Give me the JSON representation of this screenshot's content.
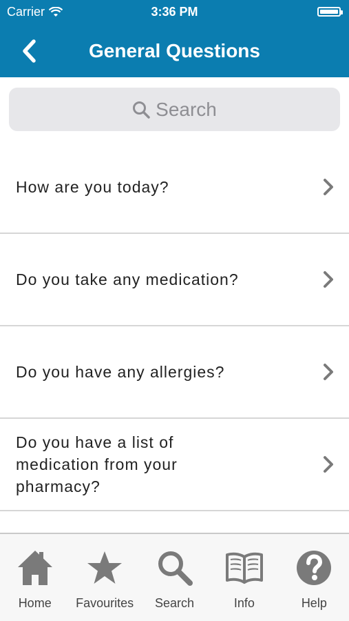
{
  "status_bar": {
    "carrier": "Carrier",
    "time": "3:36 PM"
  },
  "header": {
    "title": "General Questions",
    "back_icon": "back-chevron-icon"
  },
  "search": {
    "placeholder": "Search"
  },
  "questions": [
    {
      "label": "How are you today?"
    },
    {
      "label": "Do you take any medication?"
    },
    {
      "label": "Do you have any allergies?"
    },
    {
      "label": "Do you have a list of medication from your pharmacy?"
    }
  ],
  "tabbar": {
    "items": [
      {
        "label": "Home",
        "icon": "home-icon"
      },
      {
        "label": "Favourites",
        "icon": "star-icon"
      },
      {
        "label": "Search",
        "icon": "search-icon"
      },
      {
        "label": "Info",
        "icon": "book-icon"
      },
      {
        "label": "Help",
        "icon": "help-icon"
      }
    ]
  },
  "colors": {
    "header_bg": "#0b7db0",
    "icon_gray": "#7a7a7a"
  }
}
